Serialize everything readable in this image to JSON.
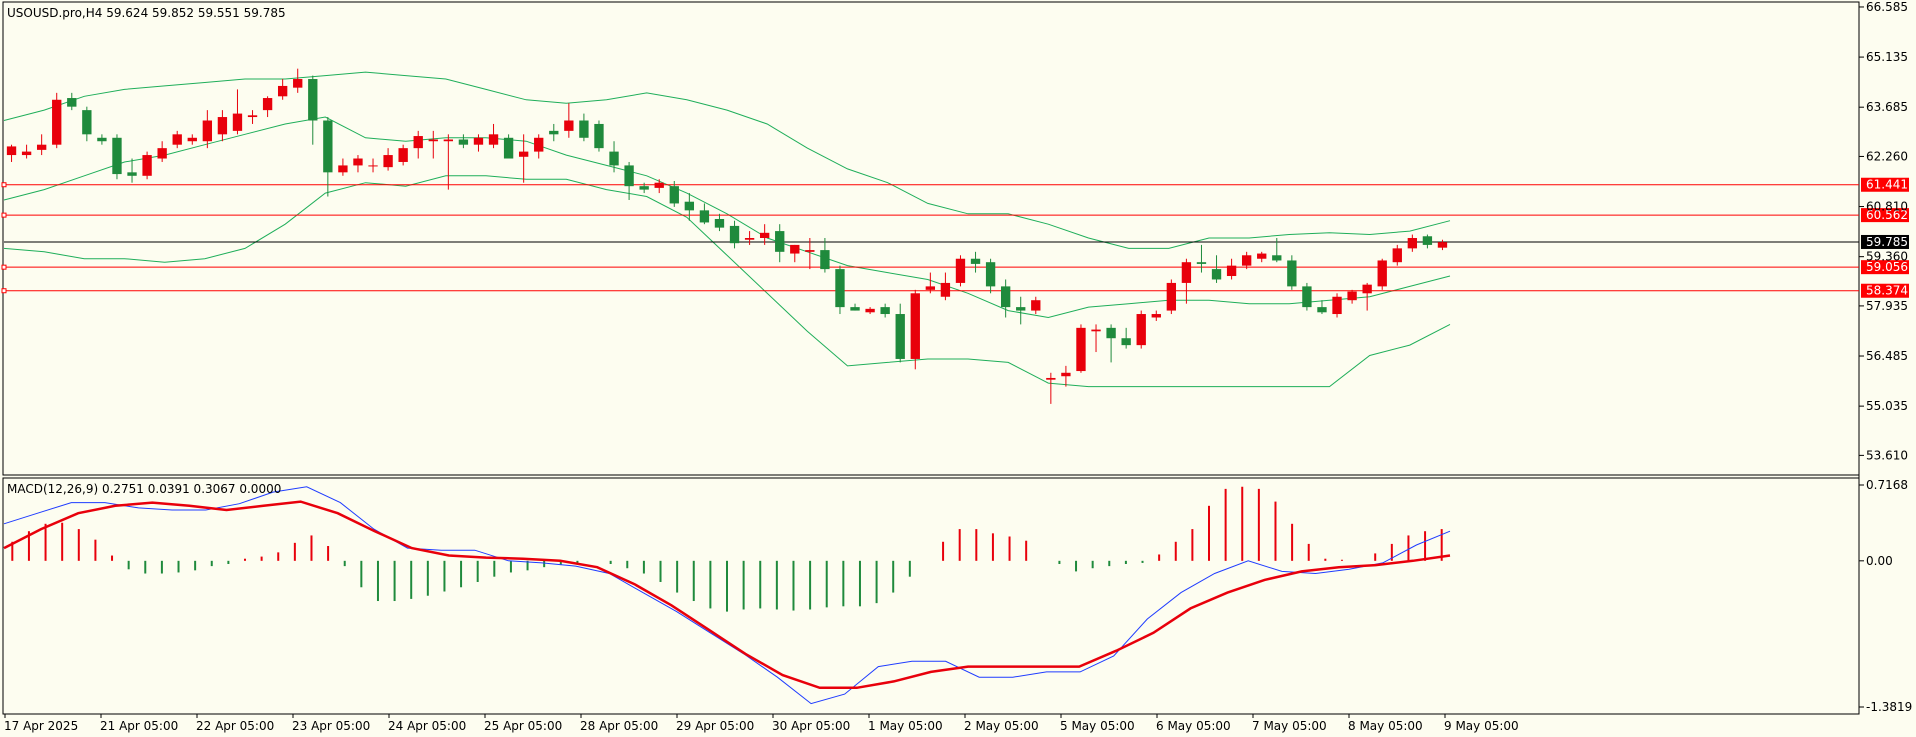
{
  "header": {
    "symbol_line": "USOUSD.pro,H4  59.624 59.852 59.551 59.785",
    "macd_line": "MACD(12,26,9) 0.2751 0.0391 0.3067 0.0000"
  },
  "colors": {
    "background": "#fdfdf0",
    "bull": "#e8000b",
    "bear": "#1f8a3c",
    "band": "#1fae5a",
    "hline": "#ff0000",
    "current": "#000000",
    "macd_hist_pos": "#e8000b",
    "macd_hist_neg": "#1f8a3c",
    "macd_main": "#1f3cff",
    "macd_signal": "#e8000b"
  },
  "chart_data": {
    "type": "candlestick",
    "symbol": "USOUSD.pro",
    "timeframe": "H4",
    "indicators": [
      "Bollinger Bands",
      "MACD(12,26,9)"
    ],
    "price_axis": {
      "ticks": [
        "66.585",
        "65.135",
        "63.685",
        "62.260",
        "60.810",
        "59.360",
        "57.935",
        "56.485",
        "55.035",
        "53.610"
      ],
      "range": [
        53.1,
        66.7
      ]
    },
    "time_axis": {
      "labels": [
        "17 Apr 2025",
        "21 Apr 05:00",
        "22 Apr 05:00",
        "23 Apr 05:00",
        "24 Apr 05:00",
        "25 Apr 05:00",
        "28 Apr 05:00",
        "29 Apr 05:00",
        "30 Apr 05:00",
        "1 May 05:00",
        "2 May 05:00",
        "5 May 05:00",
        "6 May 05:00",
        "7 May 05:00",
        "8 May 05:00",
        "9 May 05:00"
      ]
    },
    "price_levels": [
      {
        "label": "61.441",
        "value": 61.441
      },
      {
        "label": "60.562",
        "value": 60.562
      },
      {
        "label": "59.056",
        "value": 59.056
      },
      {
        "label": "58.374",
        "value": 58.374
      }
    ],
    "current_price": {
      "label": "59.785",
      "value": 59.785
    },
    "candles": [
      {
        "o": 62.3,
        "h": 62.6,
        "l": 62.1,
        "c": 62.55
      },
      {
        "o": 62.3,
        "h": 62.6,
        "l": 62.2,
        "c": 62.4
      },
      {
        "o": 62.45,
        "h": 62.9,
        "l": 62.3,
        "c": 62.6
      },
      {
        "o": 62.6,
        "h": 64.1,
        "l": 62.5,
        "c": 63.9
      },
      {
        "o": 63.95,
        "h": 64.1,
        "l": 63.6,
        "c": 63.7
      },
      {
        "o": 63.6,
        "h": 63.7,
        "l": 62.7,
        "c": 62.9
      },
      {
        "o": 62.8,
        "h": 62.9,
        "l": 62.6,
        "c": 62.7
      },
      {
        "o": 62.8,
        "h": 62.9,
        "l": 61.6,
        "c": 61.75
      },
      {
        "o": 61.8,
        "h": 62.2,
        "l": 61.5,
        "c": 61.7
      },
      {
        "o": 61.7,
        "h": 62.4,
        "l": 61.6,
        "c": 62.3
      },
      {
        "o": 62.2,
        "h": 62.7,
        "l": 62.1,
        "c": 62.5
      },
      {
        "o": 62.6,
        "h": 63.0,
        "l": 62.5,
        "c": 62.9
      },
      {
        "o": 62.7,
        "h": 62.9,
        "l": 62.6,
        "c": 62.8
      },
      {
        "o": 62.7,
        "h": 63.6,
        "l": 62.5,
        "c": 63.3
      },
      {
        "o": 62.9,
        "h": 63.6,
        "l": 62.7,
        "c": 63.4
      },
      {
        "o": 63.0,
        "h": 64.2,
        "l": 62.9,
        "c": 63.5
      },
      {
        "o": 63.4,
        "h": 63.6,
        "l": 63.2,
        "c": 63.45
      },
      {
        "o": 63.6,
        "h": 64.0,
        "l": 63.4,
        "c": 63.95
      },
      {
        "o": 64.0,
        "h": 64.5,
        "l": 63.9,
        "c": 64.3
      },
      {
        "o": 64.25,
        "h": 64.8,
        "l": 64.1,
        "c": 64.5
      },
      {
        "o": 64.5,
        "h": 64.6,
        "l": 62.6,
        "c": 63.3
      },
      {
        "o": 63.3,
        "h": 63.4,
        "l": 61.1,
        "c": 61.8
      },
      {
        "o": 61.8,
        "h": 62.2,
        "l": 61.7,
        "c": 62.0
      },
      {
        "o": 62.0,
        "h": 62.3,
        "l": 61.8,
        "c": 62.2
      },
      {
        "o": 62.0,
        "h": 62.2,
        "l": 61.8,
        "c": 62.0
      },
      {
        "o": 61.95,
        "h": 62.5,
        "l": 61.85,
        "c": 62.3
      },
      {
        "o": 62.1,
        "h": 62.6,
        "l": 62.0,
        "c": 62.5
      },
      {
        "o": 62.5,
        "h": 63.0,
        "l": 62.2,
        "c": 62.85
      },
      {
        "o": 62.7,
        "h": 63.0,
        "l": 62.2,
        "c": 62.75
      },
      {
        "o": 62.7,
        "h": 62.9,
        "l": 61.3,
        "c": 62.75
      },
      {
        "o": 62.75,
        "h": 62.9,
        "l": 62.5,
        "c": 62.6
      },
      {
        "o": 62.6,
        "h": 62.9,
        "l": 62.4,
        "c": 62.8
      },
      {
        "o": 62.6,
        "h": 63.2,
        "l": 62.5,
        "c": 62.9
      },
      {
        "o": 62.8,
        "h": 62.9,
        "l": 62.2,
        "c": 62.2
      },
      {
        "o": 62.25,
        "h": 62.9,
        "l": 61.5,
        "c": 62.4
      },
      {
        "o": 62.4,
        "h": 62.9,
        "l": 62.2,
        "c": 62.8
      },
      {
        "o": 63.0,
        "h": 63.2,
        "l": 62.7,
        "c": 62.9
      },
      {
        "o": 63.0,
        "h": 63.8,
        "l": 62.8,
        "c": 63.3
      },
      {
        "o": 63.3,
        "h": 63.5,
        "l": 62.7,
        "c": 62.8
      },
      {
        "o": 63.2,
        "h": 63.3,
        "l": 62.4,
        "c": 62.5
      },
      {
        "o": 62.4,
        "h": 62.7,
        "l": 61.8,
        "c": 62.0
      },
      {
        "o": 62.0,
        "h": 62.1,
        "l": 61.0,
        "c": 61.4
      },
      {
        "o": 61.4,
        "h": 61.5,
        "l": 61.2,
        "c": 61.3
      },
      {
        "o": 61.35,
        "h": 61.6,
        "l": 61.2,
        "c": 61.5
      },
      {
        "o": 61.4,
        "h": 61.55,
        "l": 60.8,
        "c": 60.9
      },
      {
        "o": 60.95,
        "h": 61.2,
        "l": 60.4,
        "c": 60.7
      },
      {
        "o": 60.7,
        "h": 60.9,
        "l": 60.3,
        "c": 60.35
      },
      {
        "o": 60.45,
        "h": 60.6,
        "l": 60.1,
        "c": 60.2
      },
      {
        "o": 60.25,
        "h": 60.4,
        "l": 59.6,
        "c": 59.75
      },
      {
        "o": 59.85,
        "h": 60.1,
        "l": 59.7,
        "c": 59.9
      },
      {
        "o": 59.9,
        "h": 60.3,
        "l": 59.7,
        "c": 60.05
      },
      {
        "o": 60.1,
        "h": 60.3,
        "l": 59.2,
        "c": 59.5
      },
      {
        "o": 59.45,
        "h": 59.7,
        "l": 59.2,
        "c": 59.7
      },
      {
        "o": 59.5,
        "h": 59.9,
        "l": 59.0,
        "c": 59.55
      },
      {
        "o": 59.55,
        "h": 59.9,
        "l": 58.9,
        "c": 59.0
      },
      {
        "o": 59.0,
        "h": 59.1,
        "l": 57.7,
        "c": 57.9
      },
      {
        "o": 57.9,
        "h": 58.0,
        "l": 57.8,
        "c": 57.8
      },
      {
        "o": 57.75,
        "h": 57.9,
        "l": 57.7,
        "c": 57.85
      },
      {
        "o": 57.9,
        "h": 58.0,
        "l": 57.6,
        "c": 57.7
      },
      {
        "o": 57.7,
        "h": 58.0,
        "l": 56.3,
        "c": 56.4
      },
      {
        "o": 56.4,
        "h": 58.4,
        "l": 56.1,
        "c": 58.3
      },
      {
        "o": 58.4,
        "h": 58.9,
        "l": 58.3,
        "c": 58.5
      },
      {
        "o": 58.2,
        "h": 58.9,
        "l": 58.1,
        "c": 58.6
      },
      {
        "o": 58.6,
        "h": 59.4,
        "l": 58.5,
        "c": 59.3
      },
      {
        "o": 59.3,
        "h": 59.5,
        "l": 58.9,
        "c": 59.15
      },
      {
        "o": 59.2,
        "h": 59.3,
        "l": 58.3,
        "c": 58.5
      },
      {
        "o": 58.5,
        "h": 58.7,
        "l": 57.6,
        "c": 57.9
      },
      {
        "o": 57.9,
        "h": 58.2,
        "l": 57.4,
        "c": 57.8
      },
      {
        "o": 57.8,
        "h": 58.2,
        "l": 57.7,
        "c": 58.1
      },
      {
        "o": 55.8,
        "h": 56.0,
        "l": 55.1,
        "c": 55.85
      },
      {
        "o": 55.9,
        "h": 56.2,
        "l": 55.6,
        "c": 56.0
      },
      {
        "o": 56.05,
        "h": 57.4,
        "l": 56.0,
        "c": 57.3
      },
      {
        "o": 57.2,
        "h": 57.4,
        "l": 56.6,
        "c": 57.25
      },
      {
        "o": 57.3,
        "h": 57.4,
        "l": 56.3,
        "c": 57.0
      },
      {
        "o": 57.0,
        "h": 57.3,
        "l": 56.7,
        "c": 56.8
      },
      {
        "o": 56.8,
        "h": 57.8,
        "l": 56.7,
        "c": 57.7
      },
      {
        "o": 57.6,
        "h": 57.8,
        "l": 57.5,
        "c": 57.7
      },
      {
        "o": 57.8,
        "h": 58.7,
        "l": 57.7,
        "c": 58.6
      },
      {
        "o": 58.6,
        "h": 59.3,
        "l": 58.0,
        "c": 59.2
      },
      {
        "o": 59.2,
        "h": 59.7,
        "l": 58.9,
        "c": 59.15
      },
      {
        "o": 59.0,
        "h": 59.4,
        "l": 58.6,
        "c": 58.7
      },
      {
        "o": 58.8,
        "h": 59.3,
        "l": 58.7,
        "c": 59.1
      },
      {
        "o": 59.1,
        "h": 59.5,
        "l": 59.0,
        "c": 59.4
      },
      {
        "o": 59.3,
        "h": 59.5,
        "l": 59.2,
        "c": 59.45
      },
      {
        "o": 59.4,
        "h": 59.9,
        "l": 59.2,
        "c": 59.25
      },
      {
        "o": 59.25,
        "h": 59.4,
        "l": 58.4,
        "c": 58.5
      },
      {
        "o": 58.5,
        "h": 58.6,
        "l": 57.8,
        "c": 57.9
      },
      {
        "o": 57.9,
        "h": 58.1,
        "l": 57.7,
        "c": 57.75
      },
      {
        "o": 57.7,
        "h": 58.3,
        "l": 57.6,
        "c": 58.2
      },
      {
        "o": 58.1,
        "h": 58.4,
        "l": 58.0,
        "c": 58.35
      },
      {
        "o": 58.3,
        "h": 58.6,
        "l": 57.8,
        "c": 58.55
      },
      {
        "o": 58.5,
        "h": 59.3,
        "l": 58.4,
        "c": 59.25
      },
      {
        "o": 59.2,
        "h": 59.7,
        "l": 59.1,
        "c": 59.6
      },
      {
        "o": 59.6,
        "h": 60.0,
        "l": 59.5,
        "c": 59.9
      },
      {
        "o": 59.95,
        "h": 60.0,
        "l": 59.6,
        "c": 59.7
      },
      {
        "o": 59.62,
        "h": 59.85,
        "l": 59.55,
        "c": 59.78
      }
    ],
    "bollinger": {
      "upper": [
        63.3,
        63.6,
        64.0,
        64.2,
        64.3,
        64.4,
        64.5,
        64.5,
        64.6,
        64.7,
        64.6,
        64.5,
        64.2,
        63.9,
        63.8,
        63.9,
        64.1,
        63.9,
        63.6,
        63.2,
        62.5,
        61.9,
        61.5,
        60.9,
        60.6,
        60.6,
        60.3,
        59.9,
        59.6,
        59.6,
        59.9,
        59.9,
        60.0,
        60.05,
        60.0,
        60.1,
        60.4
      ],
      "middle": [
        61.0,
        61.3,
        61.7,
        62.1,
        62.3,
        62.6,
        62.9,
        63.2,
        63.4,
        62.8,
        62.7,
        62.8,
        62.8,
        62.7,
        62.3,
        62.0,
        61.7,
        61.2,
        60.6,
        59.9,
        59.5,
        59.1,
        58.9,
        58.7,
        58.3,
        57.8,
        57.6,
        57.9,
        58.0,
        58.1,
        58.1,
        58.0,
        58.0,
        58.1,
        58.2,
        58.5,
        58.8
      ],
      "lower": [
        59.6,
        59.5,
        59.3,
        59.3,
        59.2,
        59.3,
        59.6,
        60.3,
        61.2,
        61.5,
        61.4,
        61.7,
        61.7,
        61.6,
        61.6,
        61.3,
        61.1,
        60.5,
        59.4,
        58.3,
        57.2,
        56.2,
        56.3,
        56.4,
        56.4,
        56.3,
        55.7,
        55.6,
        55.6,
        55.6,
        55.6,
        55.6,
        55.6,
        55.6,
        56.5,
        56.8,
        57.4
      ]
    },
    "macd": {
      "axis_ticks": [
        "0.7168",
        "0.00",
        "-1.3819"
      ],
      "range": [
        -1.3819,
        0.7168
      ],
      "histogram": [
        0.18,
        0.28,
        0.35,
        0.36,
        0.3,
        0.2,
        0.05,
        -0.08,
        -0.12,
        -0.12,
        -0.11,
        -0.09,
        -0.05,
        -0.03,
        0.02,
        0.04,
        0.08,
        0.17,
        0.24,
        0.14,
        -0.05,
        -0.25,
        -0.38,
        -0.38,
        -0.36,
        -0.33,
        -0.29,
        -0.25,
        -0.2,
        -0.15,
        -0.11,
        -0.09,
        -0.06,
        -0.04,
        -0.02,
        0.0,
        -0.03,
        -0.07,
        -0.12,
        -0.2,
        -0.3,
        -0.38,
        -0.45,
        -0.48,
        -0.46,
        -0.45,
        -0.46,
        -0.47,
        -0.46,
        -0.44,
        -0.43,
        -0.43,
        -0.4,
        -0.3,
        -0.15,
        0.0,
        0.18,
        0.3,
        0.3,
        0.26,
        0.23,
        0.19,
        0.0,
        -0.03,
        -0.1,
        -0.07,
        -0.05,
        -0.03,
        -0.02,
        0.06,
        0.18,
        0.3,
        0.52,
        0.68,
        0.7,
        0.68,
        0.56,
        0.35,
        0.16,
        0.02,
        0.01,
        0.0,
        0.07,
        0.16,
        0.24,
        0.28,
        0.3
      ],
      "main": [
        0.35,
        0.45,
        0.55,
        0.55,
        0.5,
        0.48,
        0.48,
        0.54,
        0.65,
        0.7,
        0.55,
        0.3,
        0.12,
        0.1,
        0.1,
        0.0,
        -0.02,
        -0.05,
        -0.12,
        -0.3,
        -0.48,
        -0.68,
        -0.88,
        -1.1,
        -1.35,
        -1.26,
        -1.0,
        -0.95,
        -0.95,
        -1.1,
        -1.1,
        -1.05,
        -1.05,
        -0.9,
        -0.55,
        -0.3,
        -0.12,
        0.0,
        -0.1,
        -0.12,
        -0.08,
        -0.02,
        0.15,
        0.28
      ],
      "signal": [
        0.12,
        0.3,
        0.45,
        0.52,
        0.55,
        0.52,
        0.48,
        0.52,
        0.56,
        0.45,
        0.28,
        0.12,
        0.05,
        0.03,
        0.02,
        0.0,
        -0.06,
        -0.22,
        -0.42,
        -0.65,
        -0.88,
        -1.08,
        -1.2,
        -1.2,
        -1.14,
        -1.05,
        -1.0,
        -1.0,
        -1.0,
        -1.0,
        -0.85,
        -0.68,
        -0.45,
        -0.3,
        -0.18,
        -0.1,
        -0.06,
        -0.04,
        0.0,
        0.05
      ]
    }
  }
}
